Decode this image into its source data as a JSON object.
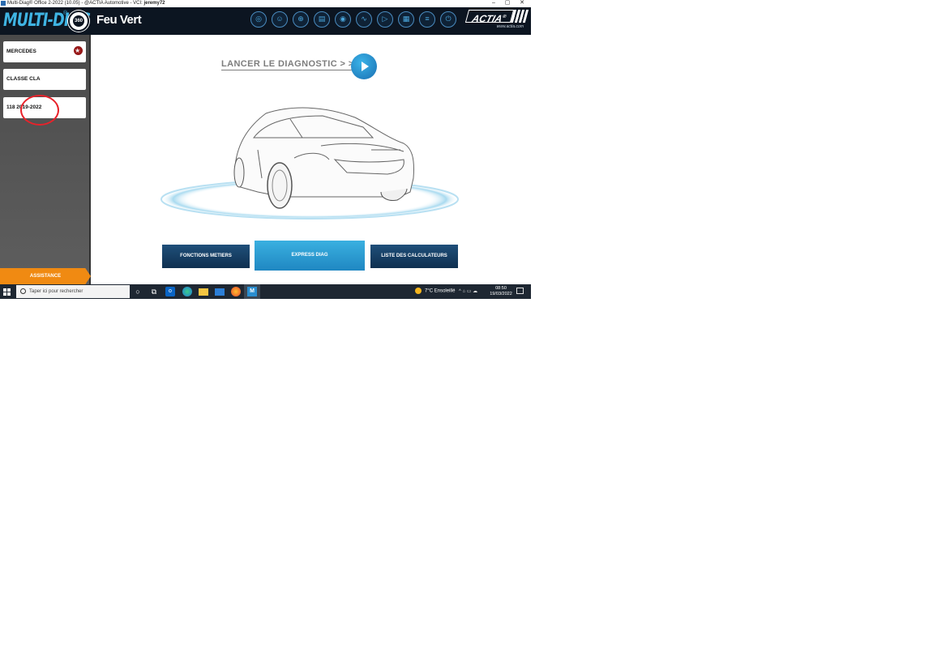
{
  "window": {
    "title_prefix": "Multi-Diag® Office 2-2022 (10.05) - @ACTIA Automotive - VCI: ",
    "user": "jeremy72",
    "controls": {
      "minimize": "–",
      "maximize": "▢",
      "close": "✕"
    }
  },
  "header": {
    "logo_text": "MULTI-DIAG",
    "logo_reg": "®",
    "logo_badge": "360",
    "brand": "Feu Vert",
    "icons": [
      "globe-icon",
      "user-search-icon",
      "network-icon",
      "keyboard-icon",
      "eye-icon",
      "waveform-icon",
      "play-circle-icon",
      "document-icon",
      "sliders-icon",
      "power-icon"
    ],
    "actia_logo": "ACTIA",
    "actia_reg": "®",
    "actia_url": "www.actia.com"
  },
  "sidebar": {
    "items": [
      {
        "label": "MERCEDES"
      },
      {
        "label": "CLASSE CLA"
      },
      {
        "label": "118 2019-2022"
      }
    ],
    "assistance_label": "ASSISTANCE"
  },
  "main": {
    "launch_label": "LANCER LE DIAGNOSTIC > > >",
    "buttons": {
      "fonctions": "FONCTIONS METIERS",
      "express": "EXPRESS DIAG",
      "calculateurs": "LISTE DES CALCULATEURS"
    }
  },
  "taskbar": {
    "search_placeholder": "Taper ici pour rechercher",
    "apps": [
      "cortana-icon",
      "task-view-icon",
      "outlook-icon",
      "edge-icon",
      "file-explorer-icon",
      "mail-icon",
      "firefox-icon",
      "multidiag-icon"
    ],
    "weather": "7°C  Ensoleillé",
    "tray": "^  ⌂  ▭  ☁",
    "time": "08:50",
    "date": "19/03/2022"
  },
  "colors": {
    "header_bg": "#0c1521",
    "accent_blue": "#3fb4e3",
    "assistance_orange": "#f08a12",
    "annotation_red": "#e8222a"
  }
}
